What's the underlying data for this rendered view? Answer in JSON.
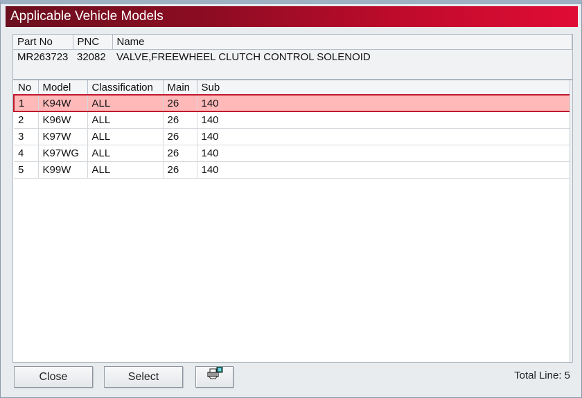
{
  "window": {
    "title": "Applicable Vehicle Models"
  },
  "part": {
    "columns": [
      "Part No",
      "PNC",
      "Name"
    ],
    "values": [
      "MR263723",
      "32082",
      "VALVE,FREEWHEEL CLUTCH CONTROL SOLENOID"
    ]
  },
  "models": {
    "columns": [
      "No",
      "Model",
      "Classification",
      "Main",
      "Sub"
    ],
    "rows": [
      [
        "1",
        "K94W",
        "ALL",
        "26",
        "140"
      ],
      [
        "2",
        "K96W",
        "ALL",
        "26",
        "140"
      ],
      [
        "3",
        "K97W",
        "ALL",
        "26",
        "140"
      ],
      [
        "4",
        "K97WG",
        "ALL",
        "26",
        "140"
      ],
      [
        "5",
        "K99W",
        "ALL",
        "26",
        "140"
      ]
    ],
    "selected_row": 0
  },
  "buttons": {
    "close": "Close",
    "select": "Select",
    "print_icon": "printer-icon"
  },
  "footer": {
    "total": "Total Line: 5"
  },
  "colors": {
    "title_start": "#6b0f1e",
    "title_end": "#e00c36",
    "selected_bg": "#ffb9b9",
    "selected_border": "#c0162c"
  }
}
